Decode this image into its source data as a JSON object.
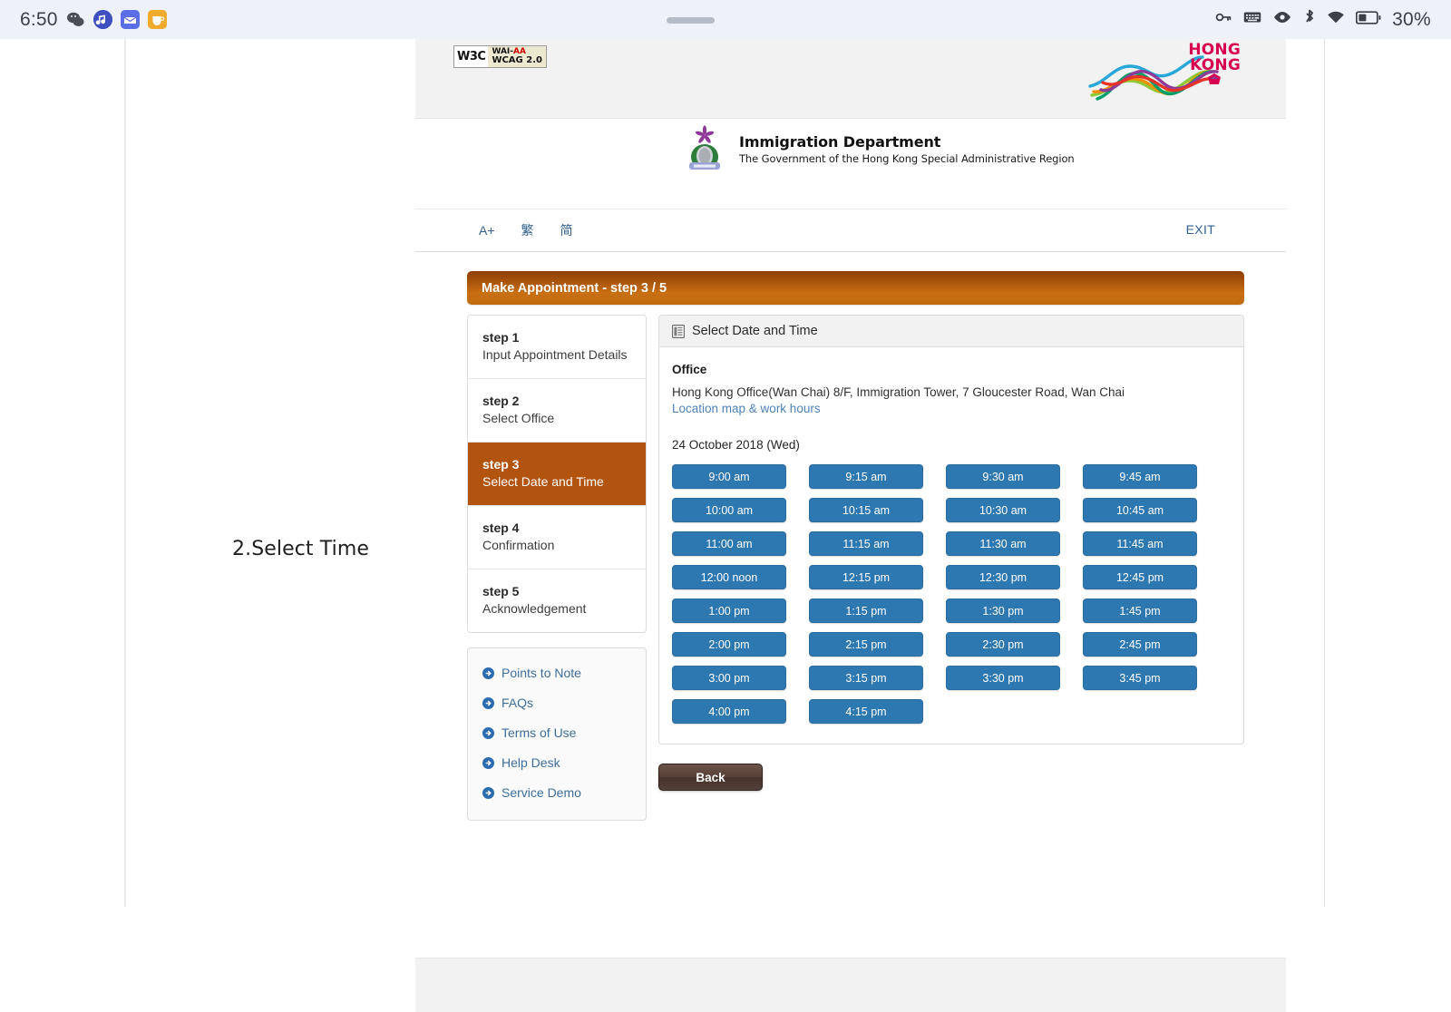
{
  "statusbar": {
    "time": "6:50",
    "app_icons": [
      "wechat-icon",
      "music-icon",
      "mail-icon",
      "cup-icon"
    ],
    "right_icons": [
      "vpn-key-icon",
      "keyboard-icon",
      "eye-icon",
      "bluetooth-icon",
      "wifi-icon",
      "battery-icon"
    ],
    "battery": "30%"
  },
  "annotation": {
    "text": "2.Select Time"
  },
  "site": {
    "accessibility_badge": {
      "w3c": "W3C",
      "line1_pre": "WAI-",
      "line1_post": "AA",
      "line2": "WCAG 2.0"
    },
    "brand": {
      "line1": "HONG",
      "line2": "KONG"
    },
    "department": {
      "name": "Immigration Department",
      "subtitle": "The Government of the Hong Kong Special Administrative Region"
    },
    "tools": {
      "font_size": "A+",
      "traditional": "繁",
      "simplified": "简",
      "exit": "EXIT"
    }
  },
  "titlebar": {
    "text": "Make Appointment - step 3 / 5"
  },
  "steps": [
    {
      "number": "step 1",
      "label": "Input Appointment Details",
      "active": false
    },
    {
      "number": "step 2",
      "label": "Select Office",
      "active": false
    },
    {
      "number": "step 3",
      "label": "Select Date and Time",
      "active": true
    },
    {
      "number": "step 4",
      "label": "Confirmation",
      "active": false
    },
    {
      "number": "step 5",
      "label": "Acknowledgement",
      "active": false
    }
  ],
  "quick_links": [
    {
      "label": "Points to Note",
      "icon": "arrow-circle-right-icon"
    },
    {
      "label": "FAQs",
      "icon": "arrow-circle-right-icon"
    },
    {
      "label": "Terms of Use",
      "icon": "arrow-circle-right-icon"
    },
    {
      "label": "Help Desk",
      "icon": "arrow-circle-right-icon"
    },
    {
      "label": "Service Demo",
      "icon": "arrow-circle-right-icon"
    }
  ],
  "panel": {
    "header": "Select Date and Time",
    "header_icon": "list-document-icon",
    "office_label": "Office",
    "office_address": "Hong Kong Office(Wan Chai) 8/F, Immigration Tower, 7 Gloucester Road, Wan Chai",
    "office_link": "Location map & work hours",
    "date": "24 October 2018 (Wed)",
    "time_slots": [
      "9:00 am",
      "9:15 am",
      "9:30 am",
      "9:45 am",
      "10:00 am",
      "10:15 am",
      "10:30 am",
      "10:45 am",
      "11:00 am",
      "11:15 am",
      "11:30 am",
      "11:45 am",
      "12:00 noon",
      "12:15 pm",
      "12:30 pm",
      "12:45 pm",
      "1:00 pm",
      "1:15 pm",
      "1:30 pm",
      "1:45 pm",
      "2:00 pm",
      "2:15 pm",
      "2:30 pm",
      "2:45 pm",
      "3:00 pm",
      "3:15 pm",
      "3:30 pm",
      "3:45 pm",
      "4:00 pm",
      "4:15 pm"
    ]
  },
  "back_button": {
    "label": "Back"
  },
  "colors": {
    "accent_orange": "#b2540f",
    "slot_blue": "#2e78b2",
    "link_blue": "#3d6e9b",
    "brand_red": "#d6004e"
  }
}
